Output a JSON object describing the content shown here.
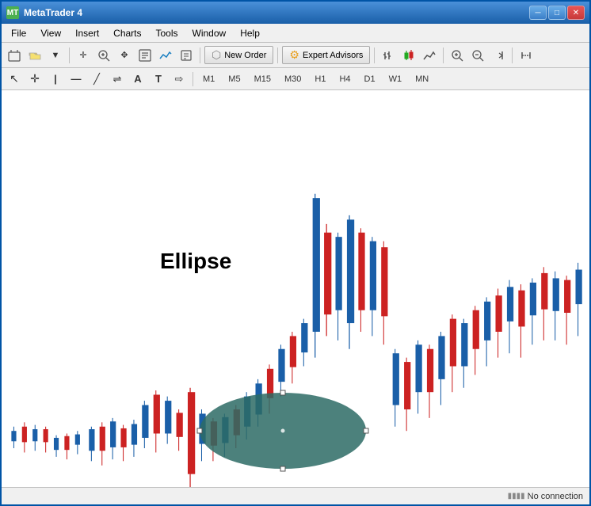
{
  "window": {
    "title": "MetaTrader 4",
    "title_icon": "MT"
  },
  "title_controls": {
    "minimize": "─",
    "maximize": "□",
    "close": "✕"
  },
  "menu": {
    "items": [
      "File",
      "View",
      "Insert",
      "Charts",
      "Tools",
      "Window",
      "Help"
    ]
  },
  "toolbar1": {
    "new_order_label": "New Order",
    "expert_advisors_label": "Expert Advisors"
  },
  "toolbar2": {
    "timeframes": [
      "M1",
      "M5",
      "M15",
      "M30",
      "H1",
      "H4",
      "D1",
      "W1",
      "MN"
    ]
  },
  "chart": {
    "ellipse_label": "Ellipse"
  },
  "status_bar": {
    "connection_icon": "▮▮▮▮",
    "connection_text": "No connection"
  }
}
